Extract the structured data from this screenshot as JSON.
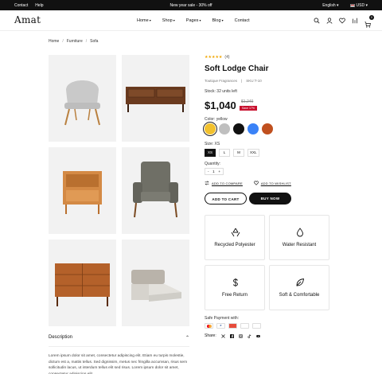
{
  "topbar": {
    "links": [
      "Contact",
      "Help"
    ],
    "announcement": "New year sale - 30% off",
    "language": "English",
    "currency": "USD"
  },
  "header": {
    "logo": "Amat",
    "nav": [
      "Home",
      "Shop",
      "Pages",
      "Blog",
      "Contact"
    ],
    "cart_count": "0"
  },
  "breadcrumb": [
    "Home",
    "Furniture",
    "Sofa"
  ],
  "product": {
    "rating_count": "(4)",
    "title": "Soft Lodge Chair",
    "vendor": "Toutique Fragrances",
    "sku": "SKU:T-10",
    "stock": "Stock: 32 units left",
    "price": "$1,040",
    "old_price": "$1,240",
    "save": "Save 17%",
    "color_label": "Color: yellow",
    "colors": [
      "#f2c12e",
      "#bfbfbf",
      "#111111",
      "#3a82f7",
      "#c0501f"
    ],
    "size_label": "Size: XS",
    "sizes": [
      "XS",
      "L",
      "M",
      "XXL"
    ],
    "qty_label": "Quantity:",
    "qty": "1",
    "add_compare": "ADD TO COMPARE",
    "add_wishlist": "ADD TO WISHLIST",
    "add_cart": "ADD TO CART",
    "buy_now": "BUY NOW"
  },
  "features": [
    {
      "label": "Recycled Polyester",
      "icon": "recycle-icon"
    },
    {
      "label": "Water Resistant",
      "icon": "water-drop-icon"
    },
    {
      "label": "Free Return",
      "icon": "dollar-icon"
    },
    {
      "label": "Soft & Comfortable",
      "icon": "leaf-icon"
    }
  ],
  "payment": {
    "label": "Safe Payment with:",
    "cards": [
      "MC",
      "PP",
      "AMEX",
      "VISA",
      "Pay",
      "GPay"
    ]
  },
  "share": {
    "label": "Share:"
  },
  "description": {
    "heading": "Description",
    "text": "Lorem ipsum dolor sit amet, consectetur adipiscing elit. Etiam eu turpis molestie, dictum est a, mattis tellus. Sed dignissim, metus nec fringilla accumsan, risus sem sollicitudin lacus, ut interdum tellus elit sed risus. Lorem ipsum dolor sit amet, consectetur adipiscing elit."
  }
}
